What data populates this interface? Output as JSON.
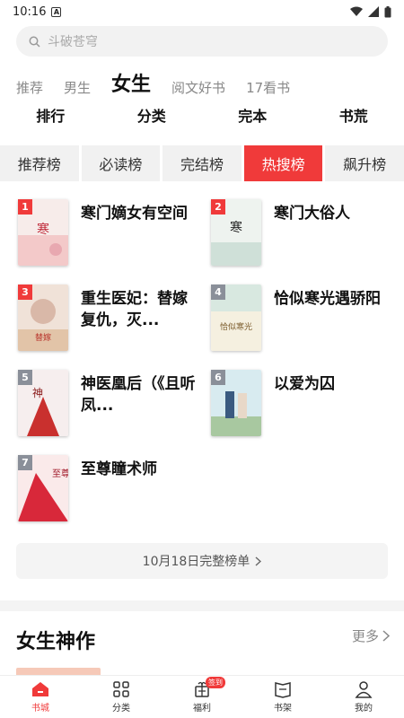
{
  "status": {
    "time": "10:16"
  },
  "search": {
    "placeholder": "斗破苍穹"
  },
  "categories": [
    "推荐",
    "男生",
    "女生",
    "阅文好书",
    "17看书"
  ],
  "subnav": [
    "排行",
    "分类",
    "完本",
    "书荒"
  ],
  "tabs": [
    "推荐榜",
    "必读榜",
    "完结榜",
    "热搜榜",
    "飙升榜"
  ],
  "books": [
    {
      "rank": "1",
      "title": "寒门嫡女有空间"
    },
    {
      "rank": "2",
      "title": "寒门大俗人"
    },
    {
      "rank": "3",
      "title": "重生医妃：替嫁复仇，灭..."
    },
    {
      "rank": "4",
      "title": "恰似寒光遇骄阳"
    },
    {
      "rank": "5",
      "title": "神医凰后（《且听凤..."
    },
    {
      "rank": "6",
      "title": "以爱为囚"
    },
    {
      "rank": "7",
      "title": "至尊瞳术师"
    }
  ],
  "full_list_button": "10月18日完整榜单",
  "section": {
    "title": "女生神作",
    "more": "更多"
  },
  "bottom_nav": [
    {
      "label": "书城",
      "icon": "home-icon"
    },
    {
      "label": "分类",
      "icon": "grid-icon"
    },
    {
      "label": "福利",
      "icon": "gift-icon",
      "badge": "签到"
    },
    {
      "label": "书架",
      "icon": "bookshelf-icon"
    },
    {
      "label": "我的",
      "icon": "user-icon"
    }
  ],
  "colors": {
    "accent": "#f03a3a",
    "rank_gray": "#8a8f99"
  }
}
